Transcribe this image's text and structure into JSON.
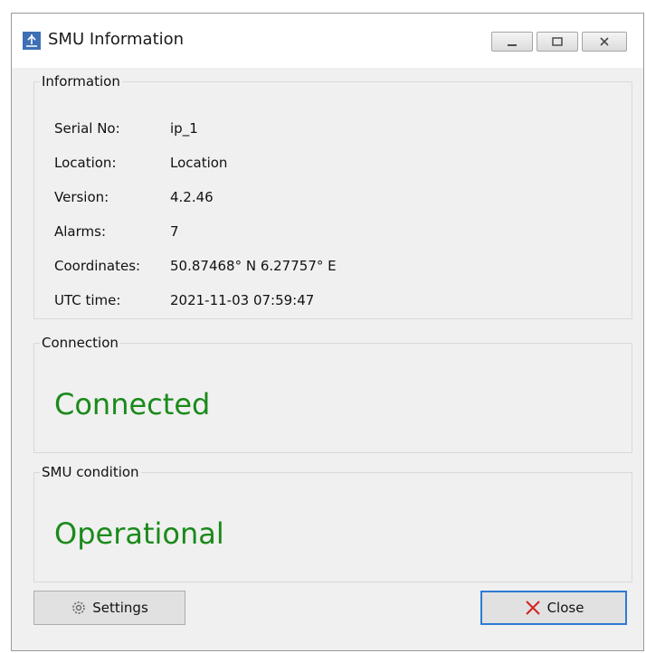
{
  "window": {
    "title": "SMU Information"
  },
  "information": {
    "legend": "Information",
    "rows": [
      {
        "label": "Serial No:",
        "value": "ip_1"
      },
      {
        "label": "Location:",
        "value": "Location"
      },
      {
        "label": "Version:",
        "value": "4.2.46"
      },
      {
        "label": "Alarms:",
        "value": "7"
      },
      {
        "label": "Coordinates:",
        "value": "50.87468° N  6.27757° E"
      },
      {
        "label": "UTC time:",
        "value": "2021-11-03  07:59:47"
      }
    ]
  },
  "connection": {
    "legend": "Connection",
    "status": "Connected",
    "status_color": "#1a8a1a"
  },
  "condition": {
    "legend": "SMU condition",
    "status": "Operational",
    "status_color": "#1a8a1a"
  },
  "buttons": {
    "settings_label": "Settings",
    "settings_icon": "gear-icon",
    "close_label": "Close",
    "close_icon": "red-x-icon"
  }
}
